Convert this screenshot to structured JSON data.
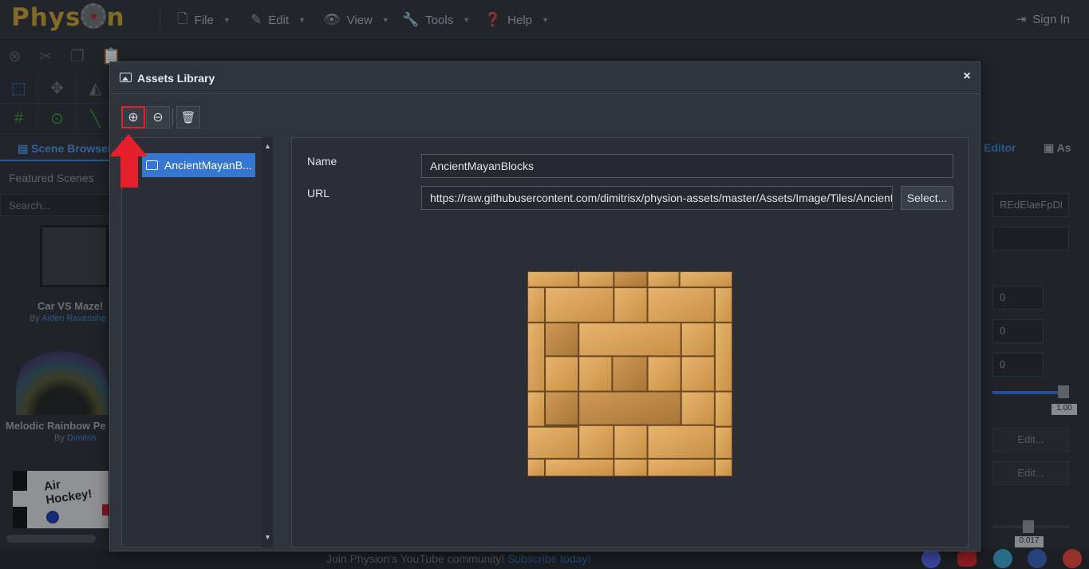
{
  "app": {
    "logo_text_left": "Phys",
    "logo_text_right": "n",
    "sign_in": "Sign In",
    "menus": [
      {
        "label": "File",
        "icon": "file-icon"
      },
      {
        "label": "Edit",
        "icon": "pencil-icon"
      },
      {
        "label": "View",
        "icon": "eye-icon"
      },
      {
        "label": "Tools",
        "icon": "wrench-icon"
      },
      {
        "label": "Help",
        "icon": "help-icon"
      }
    ]
  },
  "left_panel": {
    "tab_label": "Scene Browser",
    "featured_label": "Featured Scenes",
    "search_placeholder": "Search...",
    "scenes": [
      {
        "title": "Car VS Maze!",
        "by_prefix": "By",
        "author": "Aiden Ravenshe"
      },
      {
        "title": "Melodic Rainbow Pe",
        "by_prefix": "By",
        "author": "Dimitris"
      },
      {
        "title": "Air Hockey!"
      }
    ]
  },
  "right_panel": {
    "tab_editor": "Editor",
    "tab_assets": "As",
    "id_value": "REdElaeFpDl",
    "number_values": [
      "0",
      "0",
      "0"
    ],
    "slider_value": "1.00",
    "edit_buttons": [
      "Edit...",
      "Edit..."
    ],
    "bottom_value": "0.017"
  },
  "footer": {
    "text": "Join Physion's YouTube community!",
    "link": "Subscribe today!"
  },
  "dialog": {
    "title": "Assets Library",
    "close": "×",
    "toolbar": {
      "add": "⊕",
      "remove": "⊖",
      "delete": "🗑"
    },
    "list_items": [
      "AncientMayanB..."
    ],
    "fields": {
      "name_label": "Name",
      "name_value": "AncientMayanBlocks",
      "url_label": "URL",
      "url_value": "https://raw.githubusercontent.com/dimitrisx/physion-assets/master/Assets/Image/Tiles/AncientMayanBlocks.png",
      "select_label": "Select..."
    }
  },
  "colors": {
    "accent": "#3476d1",
    "highlight_red": "#e5202b",
    "logo_gold": "#c49b2e"
  }
}
